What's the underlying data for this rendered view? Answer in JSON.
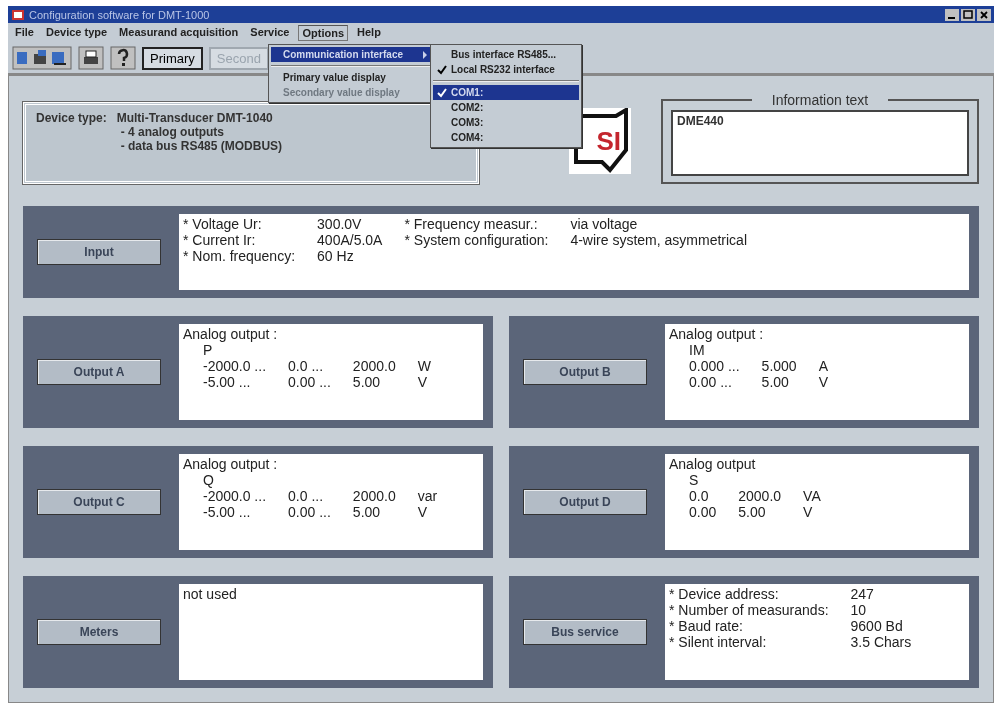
{
  "window": {
    "title": "Configuration software for DMT-1000"
  },
  "menu_bar": [
    {
      "label": "File",
      "selected": false
    },
    {
      "label": "Device type",
      "selected": false
    },
    {
      "label": "Measurand acquisition",
      "selected": false
    },
    {
      "label": "Service",
      "selected": false
    },
    {
      "label": "Options",
      "selected": true
    },
    {
      "label": "Help",
      "selected": false
    }
  ],
  "toolbar": {
    "buttons": [
      {
        "label": "Primary",
        "disabled": false
      },
      {
        "label": "Second",
        "disabled": true
      }
    ]
  },
  "options_menu": [
    {
      "label": "Communication interface",
      "kind": "submenu",
      "selected": true,
      "disabled": false
    },
    {
      "kind": "separator"
    },
    {
      "label": "Primary value display",
      "kind": "item",
      "selected": false,
      "disabled": false
    },
    {
      "label": "Secondary value display",
      "kind": "item",
      "selected": false,
      "disabled": true
    }
  ],
  "interface_submenu": [
    {
      "label": "Bus interface RS485...",
      "kind": "item",
      "checked": false,
      "selected": false
    },
    {
      "label": "Local RS232 interface",
      "kind": "item",
      "checked": true,
      "selected": false
    },
    {
      "kind": "separator"
    },
    {
      "label": "COM1:",
      "kind": "item",
      "checked": true,
      "selected": true
    },
    {
      "label": "COM2:",
      "kind": "item",
      "checked": false,
      "selected": false
    },
    {
      "label": "COM3:",
      "kind": "item",
      "checked": false,
      "selected": false
    },
    {
      "label": "COM4:",
      "kind": "item",
      "checked": false,
      "selected": false
    }
  ],
  "device": {
    "label": "Device type:",
    "lines": [
      "Multi-Transducer DMT-1040",
      "- 4 analog outputs",
      "- data bus RS485 (MODBUS)"
    ]
  },
  "logo": {
    "text": "SI"
  },
  "information": {
    "title": "Information text",
    "text": "DME440"
  },
  "input": {
    "button": "Input",
    "rows": [
      [
        "* Voltage Ur:",
        "300.0V",
        "* Frequency measur.:",
        "via voltage"
      ],
      [
        "* Current Ir:",
        "400A/5.0A",
        "* System configuration:",
        "4-wire system, asymmetrical"
      ],
      [
        "* Nom. frequency:",
        "60 Hz"
      ]
    ]
  },
  "panels": [
    {
      "button": "Output A",
      "heading": "Analog output :",
      "quantity": "P",
      "rows": [
        [
          "-2000.0 ...",
          "0.0 ...",
          "2000.0",
          "W"
        ],
        [
          "-5.00 ...",
          "0.00 ...",
          "5.00",
          "V"
        ]
      ]
    },
    {
      "button": "Output B",
      "heading": "Analog output :",
      "quantity": "IM",
      "rows": [
        [
          "0.000 ...",
          "5.000",
          "A"
        ],
        [
          "0.00 ...",
          "5.00",
          "V"
        ]
      ]
    },
    {
      "button": "Output C",
      "heading": "Analog output :",
      "quantity": "Q",
      "rows": [
        [
          "-2000.0 ...",
          "0.0 ...",
          "2000.0",
          "var"
        ],
        [
          "-5.00 ...",
          "0.00 ...",
          "5.00",
          "V"
        ]
      ]
    },
    {
      "button": "Output D",
      "heading": "Analog output",
      "quantity": "S",
      "rows": [
        [
          "0.0",
          "2000.0",
          "VA"
        ],
        [
          "0.00",
          "5.00",
          "V"
        ]
      ]
    },
    {
      "button": "Meters",
      "heading": "not used"
    },
    {
      "button": "Bus service",
      "rows": [
        [
          "* Device address:",
          "247"
        ],
        [
          "* Number of measurands:",
          "10"
        ],
        [
          "* Baud rate:",
          "9600 Bd"
        ],
        [
          "* Silent interval:",
          "3.5 Chars"
        ]
      ]
    }
  ]
}
